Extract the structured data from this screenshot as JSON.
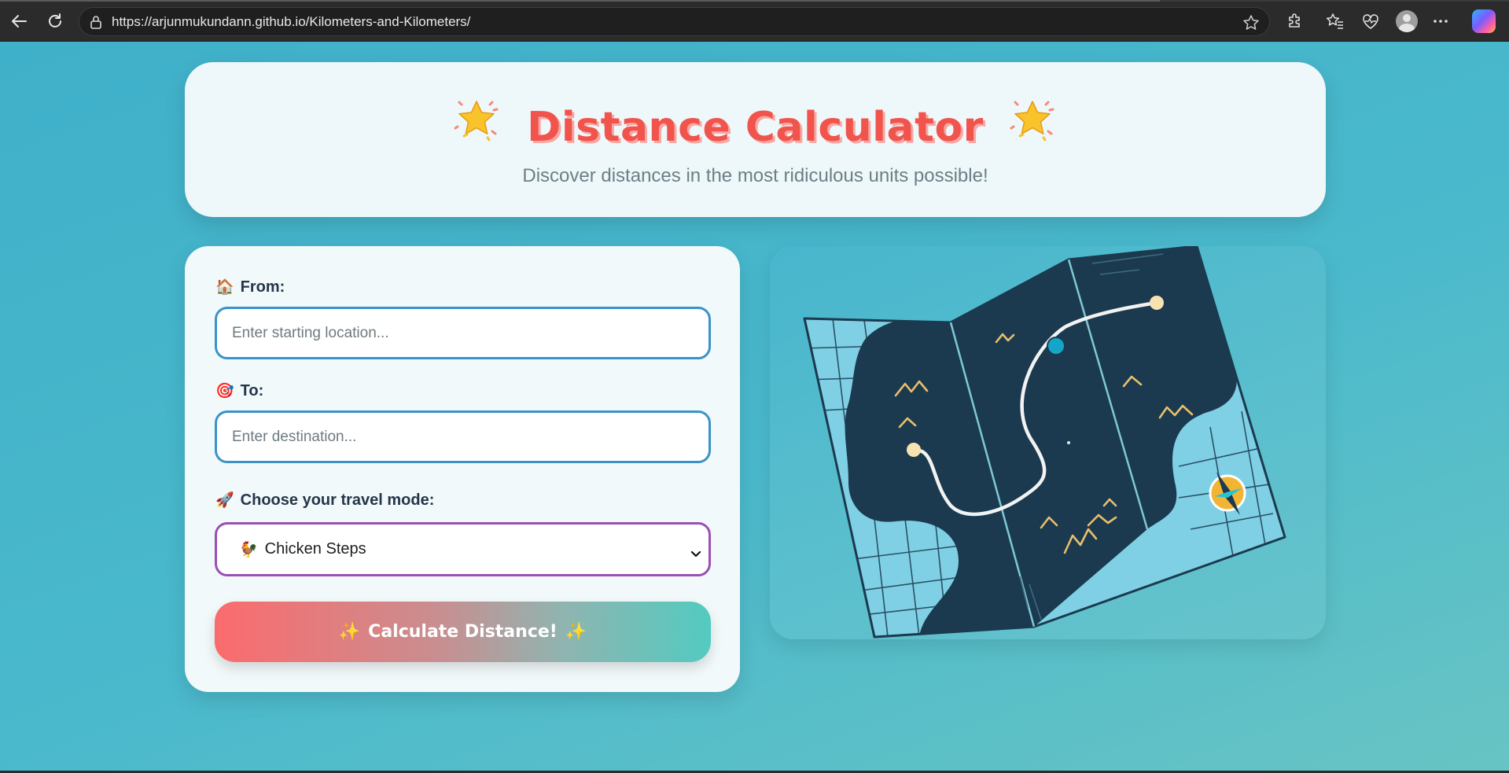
{
  "browser": {
    "url": "https://arjunmukundann.github.io/Kilometers-and-Kilometers/",
    "icons": [
      "back-icon",
      "refresh-icon",
      "lock-icon",
      "favorite-star-icon",
      "extensions-icon",
      "favorites-icon",
      "health-icon",
      "profile-icon",
      "more-icon",
      "copilot-icon"
    ]
  },
  "header": {
    "title": "Distance Calculator",
    "title_icon": "star-sparkle-icon",
    "subtitle": "Discover distances in the most ridiculous units possible!"
  },
  "form": {
    "from_icon": "🏠",
    "from_label": "From:",
    "from_placeholder": "Enter starting location...",
    "from_value": "",
    "to_icon": "🎯",
    "to_label": "To:",
    "to_placeholder": "Enter destination...",
    "to_value": "",
    "mode_icon": "🚀",
    "mode_label": "Choose your travel mode:",
    "mode_selected_icon": "🐓",
    "mode_selected": "Chicken Steps",
    "calculate_label": "Calculate Distance!",
    "sparkle": "✨"
  },
  "colors": {
    "title": "#f0544c",
    "from_border": "#3a93c8",
    "select_border": "#9a4fb5",
    "button_start": "#fb6b6d",
    "button_end": "#52cbc0",
    "map_dark": "#1b3a4f",
    "map_water": "#7fd0e4"
  },
  "illustration": {
    "name": "folded-map-illustration"
  }
}
